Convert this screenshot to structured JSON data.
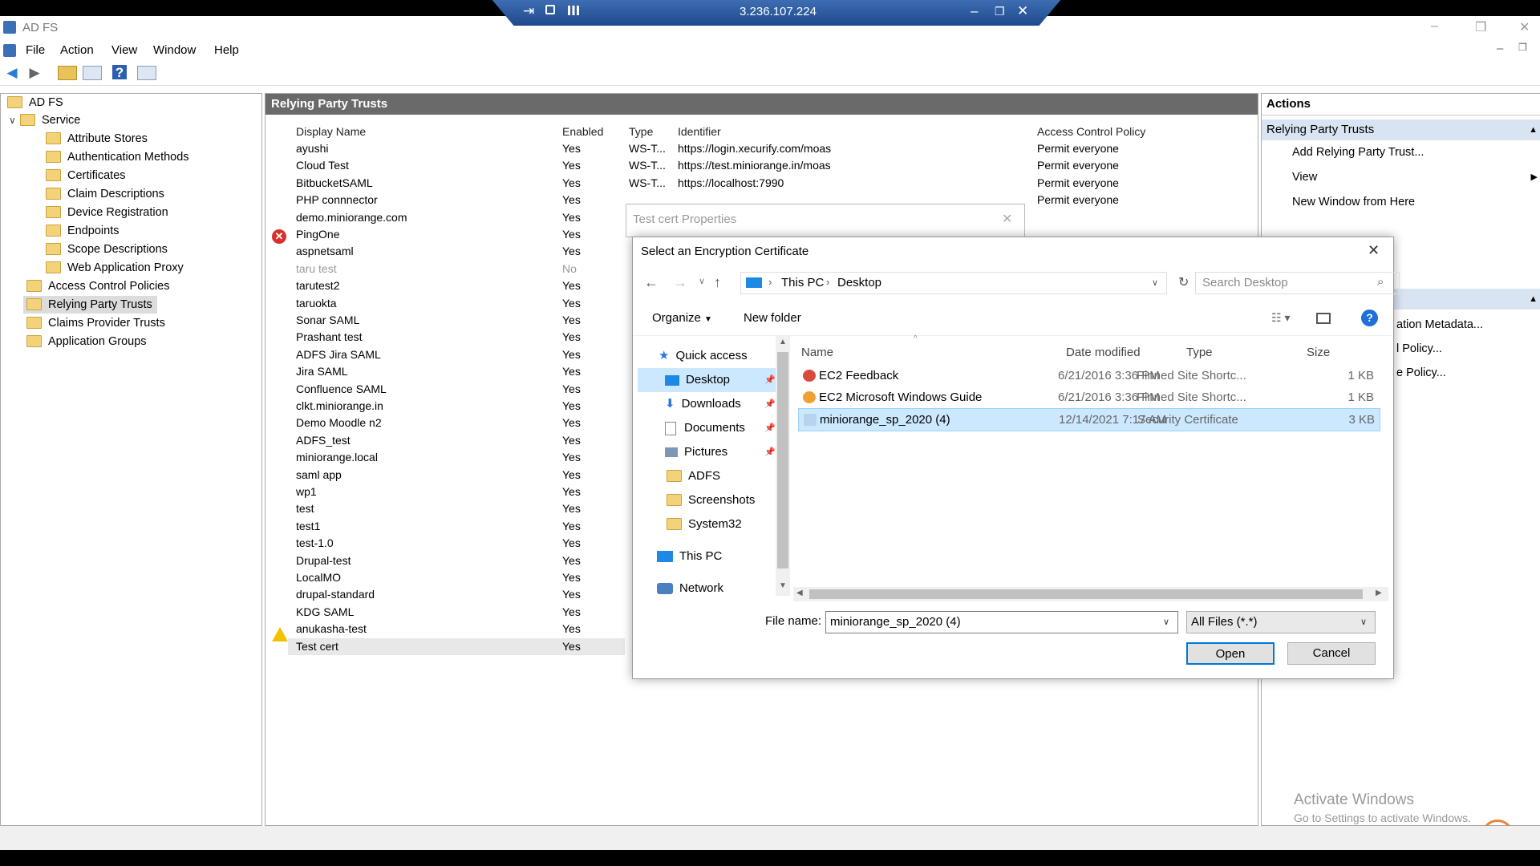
{
  "window": {
    "title": "AD FS",
    "minimize": "–",
    "restore": "❐",
    "close": "✕"
  },
  "rdp": {
    "ip": "3.236.107.224",
    "pin_icon": "⇥",
    "lock_icon": "🔒",
    "signal_icon": "▮",
    "min": "–",
    "restore": "❐",
    "close": "✕"
  },
  "menu": [
    "File",
    "Action",
    "View",
    "Window",
    "Help"
  ],
  "tree": {
    "root": "AD FS",
    "service": "Service",
    "service_children": [
      "Attribute Stores",
      "Authentication Methods",
      "Certificates",
      "Claim Descriptions",
      "Device Registration",
      "Endpoints",
      "Scope Descriptions",
      "Web Application Proxy"
    ],
    "top_items": [
      "Access Control Policies",
      "Relying Party Trusts",
      "Claims Provider Trusts",
      "Application Groups"
    ]
  },
  "middle": {
    "title": "Relying Party Trusts",
    "columns": [
      "Display Name",
      "Enabled",
      "Type",
      "Identifier",
      "Access Control Policy"
    ],
    "rows": [
      {
        "name": "ayushi",
        "enabled": "Yes",
        "type": "WS-T...",
        "id": "https://login.xecurify.com/moas",
        "policy": "Permit everyone"
      },
      {
        "name": "Cloud Test",
        "enabled": "Yes",
        "type": "WS-T...",
        "id": "https://test.miniorange.in/moas",
        "policy": "Permit everyone"
      },
      {
        "name": "BitbucketSAML",
        "enabled": "Yes",
        "type": "WS-T...",
        "id": "https://localhost:7990",
        "policy": "Permit everyone"
      },
      {
        "name": "PHP connnector",
        "enabled": "Yes",
        "type": "",
        "id": "",
        "policy": "Permit everyone"
      },
      {
        "name": "demo.miniorange.com",
        "enabled": "Yes",
        "type": "",
        "id": "",
        "policy": ""
      },
      {
        "name": "PingOne",
        "enabled": "Yes",
        "type": "",
        "id": "",
        "policy": ""
      },
      {
        "name": "aspnetsaml",
        "enabled": "Yes",
        "type": "",
        "id": "",
        "policy": ""
      },
      {
        "name": "taru test",
        "enabled": "No",
        "type": "",
        "id": "",
        "policy": ""
      },
      {
        "name": "tarutest2",
        "enabled": "Yes",
        "type": "",
        "id": "",
        "policy": ""
      },
      {
        "name": "taruokta",
        "enabled": "Yes",
        "type": "",
        "id": "",
        "policy": ""
      },
      {
        "name": "Sonar SAML",
        "enabled": "Yes",
        "type": "",
        "id": "",
        "policy": ""
      },
      {
        "name": "Prashant test",
        "enabled": "Yes",
        "type": "",
        "id": "",
        "policy": ""
      },
      {
        "name": "ADFS Jira SAML",
        "enabled": "Yes",
        "type": "",
        "id": "",
        "policy": ""
      },
      {
        "name": "Jira SAML",
        "enabled": "Yes",
        "type": "",
        "id": "",
        "policy": ""
      },
      {
        "name": "Confluence SAML",
        "enabled": "Yes",
        "type": "",
        "id": "",
        "policy": ""
      },
      {
        "name": "clkt.miniorange.in",
        "enabled": "Yes",
        "type": "",
        "id": "",
        "policy": ""
      },
      {
        "name": "Demo Moodle n2",
        "enabled": "Yes",
        "type": "",
        "id": "",
        "policy": ""
      },
      {
        "name": "ADFS_test",
        "enabled": "Yes",
        "type": "",
        "id": "",
        "policy": ""
      },
      {
        "name": "miniorange.local",
        "enabled": "Yes",
        "type": "",
        "id": "",
        "policy": ""
      },
      {
        "name": "saml app",
        "enabled": "Yes",
        "type": "",
        "id": "",
        "policy": ""
      },
      {
        "name": "wp1",
        "enabled": "Yes",
        "type": "",
        "id": "",
        "policy": ""
      },
      {
        "name": "test",
        "enabled": "Yes",
        "type": "",
        "id": "",
        "policy": ""
      },
      {
        "name": "test1",
        "enabled": "Yes",
        "type": "",
        "id": "",
        "policy": ""
      },
      {
        "name": "test-1.0",
        "enabled": "Yes",
        "type": "",
        "id": "",
        "policy": ""
      },
      {
        "name": "Drupal-test",
        "enabled": "Yes",
        "type": "",
        "id": "",
        "policy": ""
      },
      {
        "name": "LocalMO",
        "enabled": "Yes",
        "type": "",
        "id": "",
        "policy": ""
      },
      {
        "name": "drupal-standard",
        "enabled": "Yes",
        "type": "",
        "id": "",
        "policy": ""
      },
      {
        "name": "KDG SAML",
        "enabled": "Yes",
        "type": "",
        "id": "",
        "policy": ""
      },
      {
        "name": "anukasha-test",
        "enabled": "Yes",
        "type": "",
        "id": "",
        "policy": ""
      },
      {
        "name": "Test cert",
        "enabled": "Yes",
        "type": "",
        "id": "",
        "policy": ""
      }
    ]
  },
  "actions": {
    "title": "Actions",
    "section": "Relying Party Trusts",
    "items": [
      "Add Relying Party Trust...",
      "View",
      "New Window from Here"
    ],
    "partial_items": [
      "ation Metadata...",
      "l Policy...",
      "e Policy..."
    ]
  },
  "props_dialog": {
    "title": "Test cert Properties"
  },
  "file_dialog": {
    "title": "Select an Encryption Certificate",
    "breadcrumb": [
      "This PC",
      "Desktop"
    ],
    "search_placeholder": "Search Desktop",
    "organize": "Organize",
    "new_folder": "New folder",
    "nav": {
      "quick_access": "Quick access",
      "pinned": [
        "Desktop",
        "Downloads",
        "Documents",
        "Pictures"
      ],
      "folders": [
        "ADFS",
        "Screenshots",
        "System32"
      ],
      "this_pc": "This PC",
      "network": "Network"
    },
    "columns": [
      "Name",
      "Date modified",
      "Type",
      "Size"
    ],
    "files": [
      {
        "name": "EC2 Feedback",
        "date": "6/21/2016 3:36 PM",
        "type": "Pinned Site Shortc...",
        "size": "1 KB"
      },
      {
        "name": "EC2 Microsoft Windows Guide",
        "date": "6/21/2016 3:36 PM",
        "type": "Pinned Site Shortc...",
        "size": "1 KB"
      },
      {
        "name": "miniorange_sp_2020 (4)",
        "date": "12/14/2021 7:17 AM",
        "type": "Security Certificate",
        "size": "3 KB"
      }
    ],
    "filename_label": "File name:",
    "filename_value": "miniorange_sp_2020 (4)",
    "filter": "All Files (*.*)",
    "open": "Open",
    "cancel": "Cancel"
  },
  "watermark": {
    "line1": "Activate Windows",
    "line2": "Go to Settings to activate Windows."
  },
  "colors": {
    "selected_row": "#cce8ff",
    "header_gray": "#6a6a6a",
    "actions_band": "#d9e4f2",
    "rdp_blue": "#2a5a9e"
  }
}
